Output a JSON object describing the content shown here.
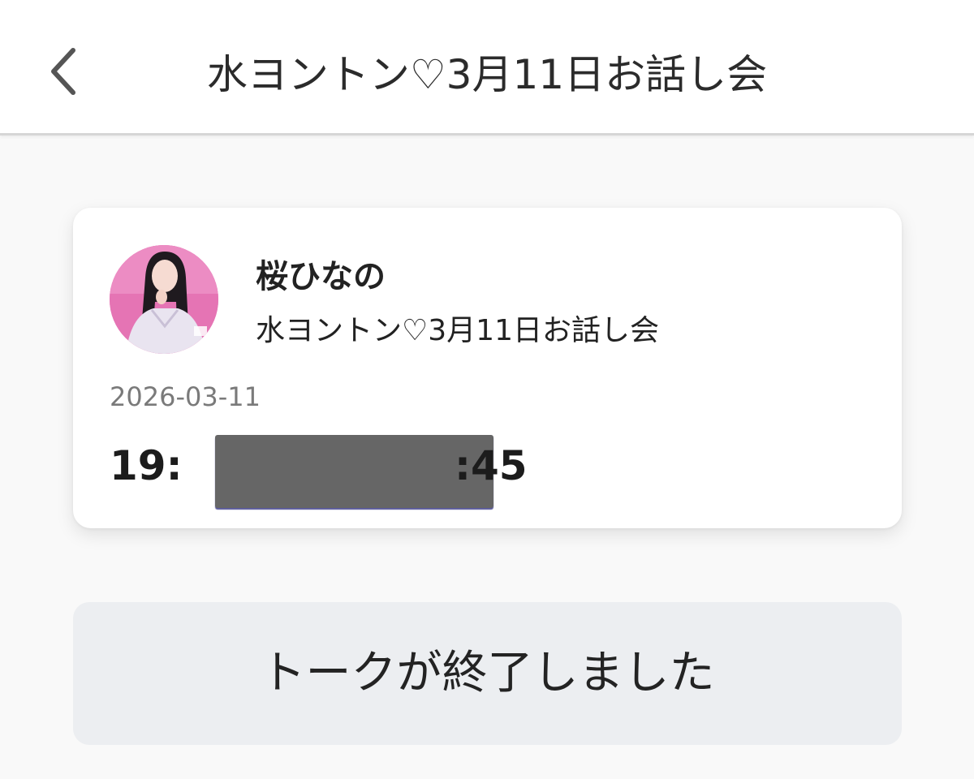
{
  "header": {
    "title": "水ヨントン♡3月11日お話し会",
    "back_icon": "chevron-left-icon"
  },
  "event_card": {
    "avatar_icon": "host-avatar-photo",
    "host_name": "桜ひなの",
    "event_name": "水ヨントン♡3月11日お話し会",
    "date": "2026-03-11",
    "time_start": "19:",
    "time_end": ":45"
  },
  "status_button": {
    "label": "トークが終了しました"
  },
  "colors": {
    "background": "#f9f9f9",
    "card": "#ffffff",
    "button_bg": "#eceef1",
    "avatar_bg": "#e574b4",
    "redaction": "#666666"
  }
}
